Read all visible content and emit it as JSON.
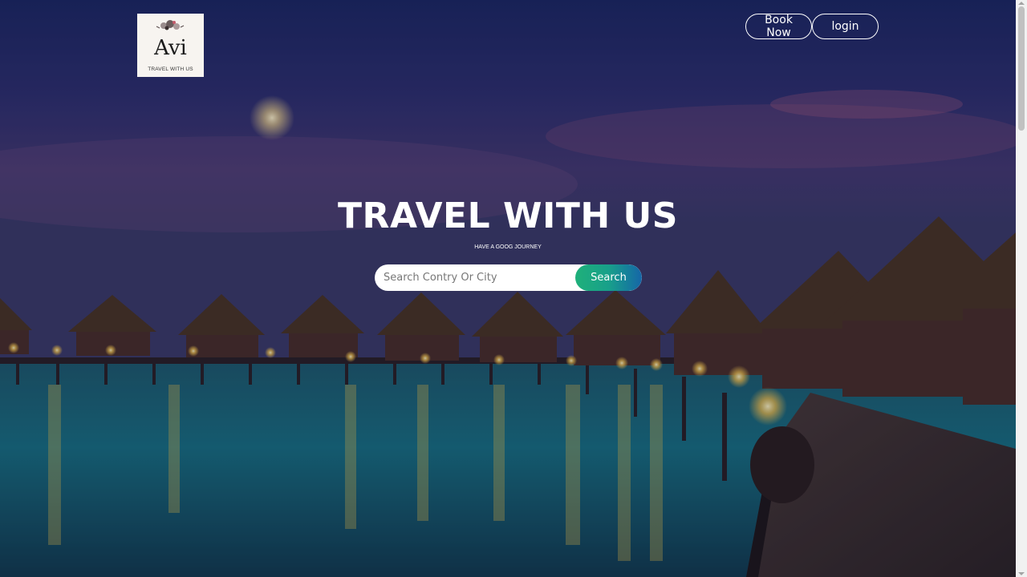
{
  "brand": {
    "logo_name": "Avi",
    "logo_tagline": "TRAVEL WITH US"
  },
  "nav": {
    "book_label": "Book Now",
    "login_label": "login"
  },
  "hero": {
    "title": "TRAVEL WITH US",
    "subtitle": "HAVE A GOOG JOURNEY"
  },
  "search": {
    "placeholder": "Search Contry Or City",
    "button_label": "Search"
  },
  "colors": {
    "search_button_start": "#1fb07a",
    "search_button_end": "#1566a8",
    "text": "#ffffff"
  }
}
